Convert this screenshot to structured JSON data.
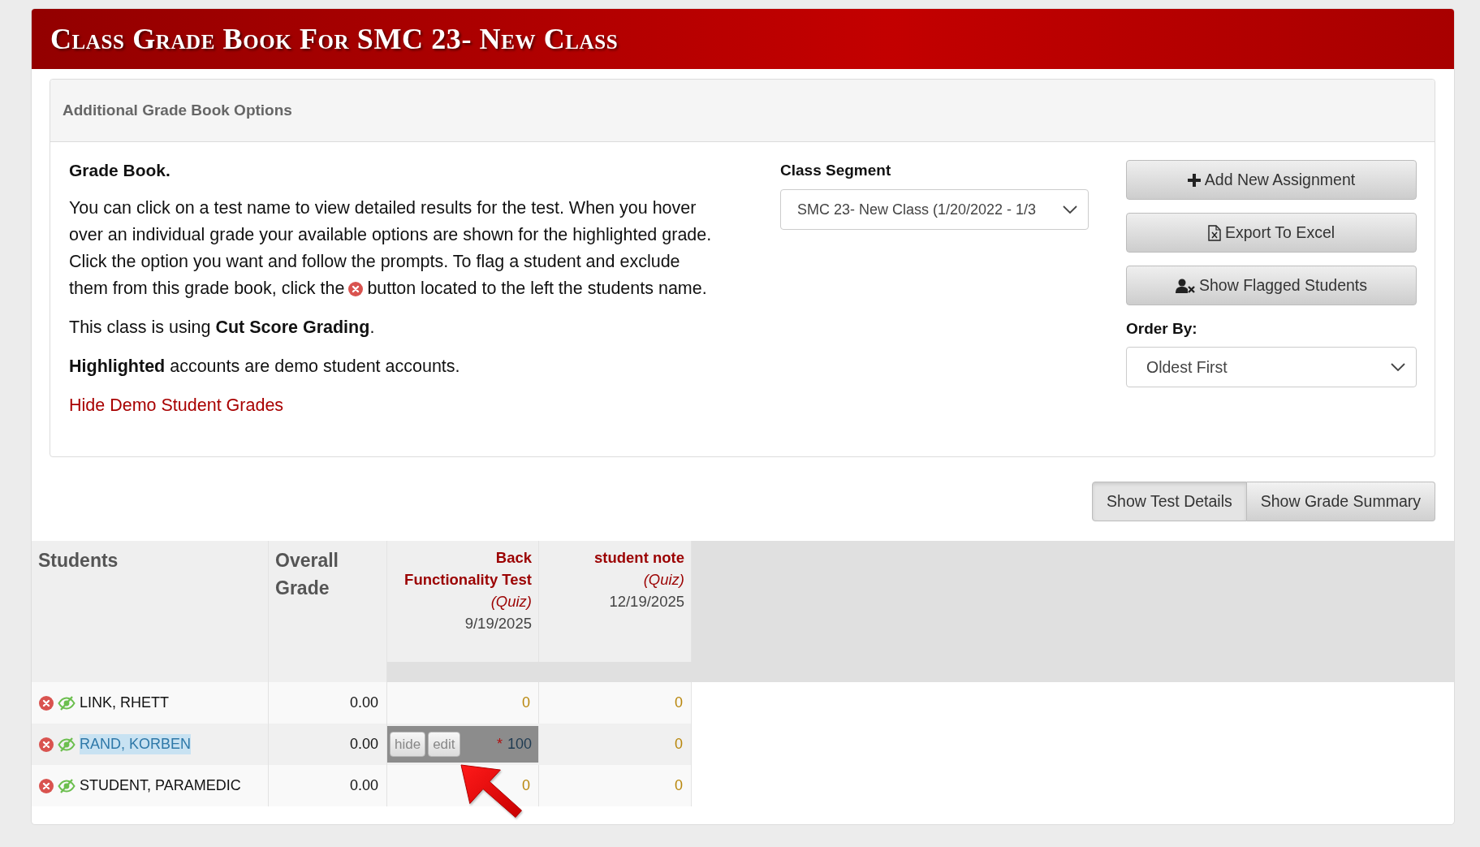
{
  "header": {
    "title": "Class Grade Book For SMC 23- New Class"
  },
  "options_panel": {
    "title": "Additional Grade Book Options",
    "heading": "Grade Book.",
    "instructions_before_icon": "You can click on a test name to view detailed results for the test. When you hover over an individual grade your available options are shown for the highlighted grade. Click the option you want and follow the prompts. To flag a student and exclude them from this grade book, click the",
    "instructions_after_icon": "button located to the left the students name.",
    "grading_note": "This class is using **Cut Score Grading**.",
    "demo_note": "**Highlighted** accounts are demo student accounts.",
    "hide_demo_link": "Hide Demo Student Grades"
  },
  "class_segment": {
    "label": "Class Segment",
    "value": "SMC 23- New Class (1/20/2022 - 1/3"
  },
  "actions": [
    {
      "label": "Add New Assignment",
      "kind": "add"
    },
    {
      "label": "Export To Excel",
      "kind": "export"
    },
    {
      "label": "Show Flagged Students",
      "kind": "flagged"
    }
  ],
  "order_by": {
    "label": "Order By:",
    "value": "Oldest First"
  },
  "view_toggle": [
    {
      "label": "Show Test Details",
      "selected": true
    },
    {
      "label": "Show Grade Summary",
      "selected": false
    }
  ],
  "table": {
    "columns": [
      {
        "label": "Students"
      },
      {
        "label": "Overall Grade"
      }
    ],
    "assignments": [
      {
        "name": "Back Functionality Test",
        "type": "(Quiz)",
        "date": "9/19/2025"
      },
      {
        "name": "student note",
        "type": "(Quiz)",
        "date": "12/19/2025"
      }
    ],
    "rows": [
      {
        "name": "LINK, RHETT",
        "demo": false,
        "overall": "0.00",
        "grades": [
          {
            "value": "0",
            "hovered": false
          },
          {
            "value": "0",
            "hovered": false
          }
        ]
      },
      {
        "name": "RAND, KORBEN",
        "demo": true,
        "overall": "0.00",
        "grades": [
          {
            "value": "100",
            "mark": "*",
            "hovered": true,
            "actions": [
              "hide",
              "edit"
            ]
          },
          {
            "value": "0",
            "hovered": false
          }
        ]
      },
      {
        "name": "STUDENT, PARAMEDIC",
        "demo": false,
        "overall": "0.00",
        "grades": [
          {
            "value": "0",
            "hovered": false
          },
          {
            "value": "0",
            "hovered": false
          }
        ]
      }
    ]
  }
}
